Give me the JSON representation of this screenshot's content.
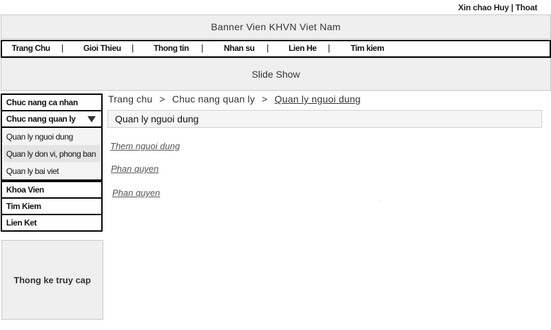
{
  "header": {
    "greeting": "Xin chao Huy | Thoat"
  },
  "banner": {
    "text": "Banner Vien KHVN Viet Nam"
  },
  "nav": {
    "items": [
      "Trang Chu",
      "Gioi Thieu",
      "Thong tin",
      "Nhan su",
      "Lien He",
      "Tim kiem"
    ],
    "separator": "|"
  },
  "slideshow": {
    "text": "Slide Show"
  },
  "sidebar": {
    "top_items": [
      "Chuc nang ca nhan",
      "Chuc nang quan ly"
    ],
    "submenu": [
      "Quan ly nguoi dung",
      "Quan ly don vi, phong ban",
      "Quan ly bai viet"
    ],
    "bottom_items": [
      "Khoa Vien",
      "Tim Kiem",
      "Lien Ket"
    ],
    "dropdown_icon": "triangle-down"
  },
  "stats": {
    "text": "Thong ke truy cap"
  },
  "breadcrumb": {
    "items": [
      "Trang chu",
      "Chuc nang quan ly",
      "Quan ly nguoi dung"
    ],
    "separator": ">"
  },
  "main": {
    "section_title": "Quan ly nguoi dung",
    "links": [
      "Them nguoi dung",
      "Phan quyen",
      "Phan quyen"
    ]
  }
}
